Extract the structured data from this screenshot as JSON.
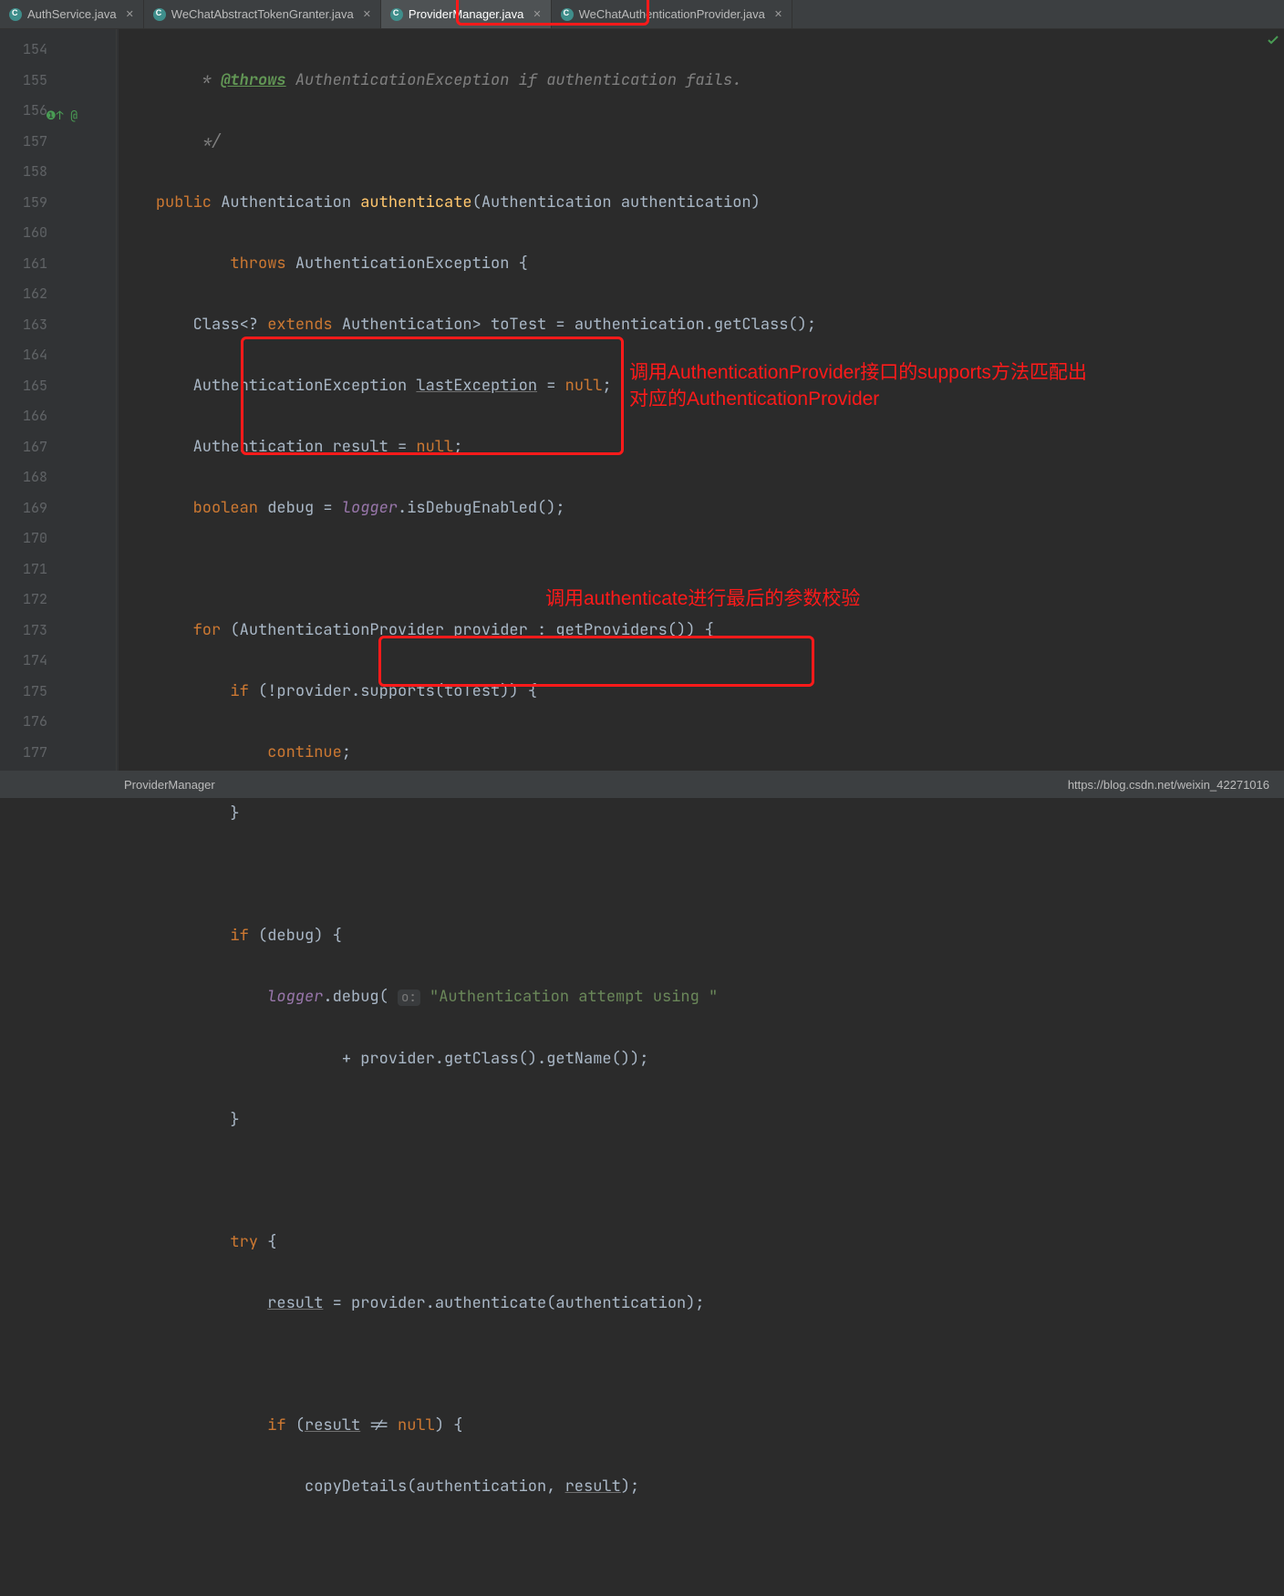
{
  "tabs": [
    {
      "label": "AuthService.java"
    },
    {
      "label": "WeChatAbstractTokenGranter.java"
    },
    {
      "label": "ProviderManager.java"
    },
    {
      "label": "WeChatAuthenticationProvider.java"
    }
  ],
  "gutter": {
    "start": 154,
    "end": 177
  },
  "code": {
    "l154": {
      "a": " * ",
      "b": "@throws",
      "c": " AuthenticationException ",
      "d": "if authentication fails."
    },
    "l155": " */",
    "l156": {
      "a": "public ",
      "b": "Authentication ",
      "c": "authenticate",
      "d": "(Authentication authentication)"
    },
    "l157": {
      "a": "throws ",
      "b": "AuthenticationException {"
    },
    "l158": {
      "a": "Class<? ",
      "b": "extends ",
      "c": "Authentication> toTest = authentication.getClass();"
    },
    "l159": {
      "a": "AuthenticationException ",
      "b": "lastException",
      "c": " = ",
      "d": "null",
      "e": ";"
    },
    "l160": {
      "a": "Authentication ",
      "b": "result",
      "c": " = ",
      "d": "null",
      "e": ";"
    },
    "l161": {
      "a": "boolean ",
      "b": "debug = ",
      "c": "logger",
      "d": ".isDebugEnabled();"
    },
    "l163": {
      "a": "for ",
      "b": "(AuthenticationProvider provider : getProviders()) {"
    },
    "l164": {
      "a": "if ",
      "b": "(!provider.supports(toTest)) {"
    },
    "l165": {
      "a": "continue",
      "b": ";"
    },
    "l166": "}",
    "l168": {
      "a": "if ",
      "b": "(debug) {"
    },
    "l169": {
      "a": "logger",
      "b": ".debug( ",
      "h": "o:",
      "c": " \"Authentication attempt using \""
    },
    "l170": "+ provider.getClass().getName());",
    "l171": "}",
    "l173": {
      "a": "try ",
      "b": "{"
    },
    "l174": {
      "a": "result",
      "b": " = ",
      "c": "provider.authenticate(authentication);"
    },
    "l176": {
      "a": "if ",
      "b": "(",
      "c": "result",
      "d": " != ",
      "e": "null",
      "f": ") {"
    },
    "l177": {
      "a": "copyDetails(authentication, ",
      "b": "result",
      "c": ");"
    }
  },
  "annotations": {
    "box1_text_l1": "调用AuthenticationProvider接口的supports方法匹配出",
    "box1_text_l2": "对应的AuthenticationProvider",
    "box2_text": "调用authenticate进行最后的参数校验"
  },
  "status": {
    "breadcrumb": "ProviderManager",
    "url": "https://blog.csdn.net/weixin_42271016"
  },
  "override_mark": "@"
}
